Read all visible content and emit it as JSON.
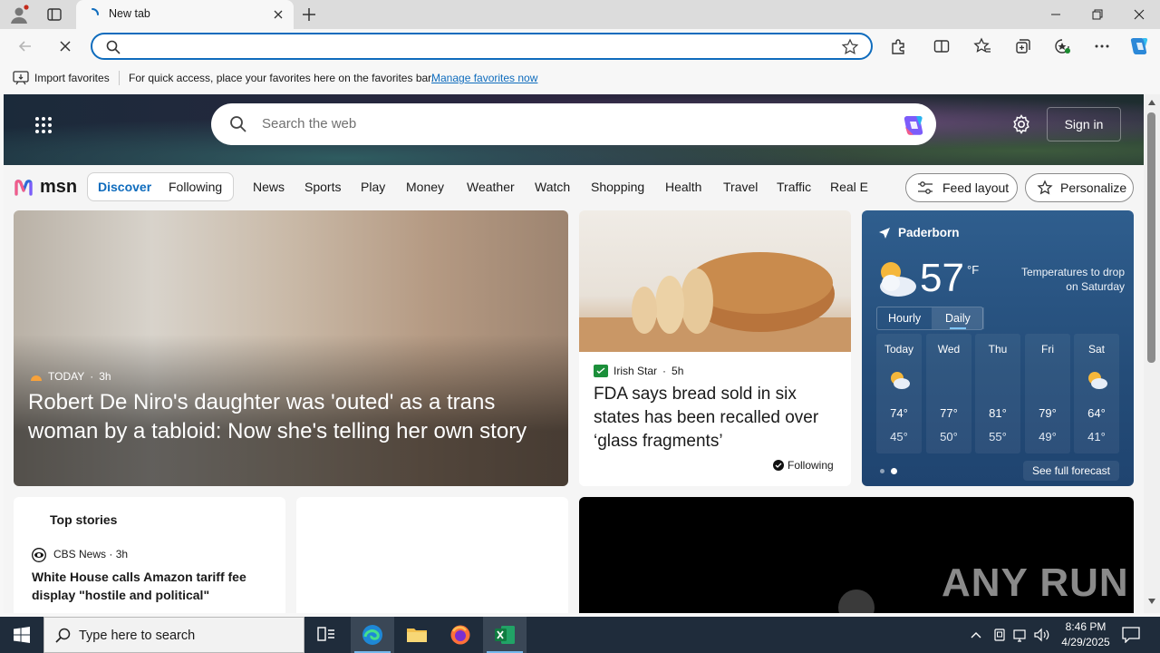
{
  "browser": {
    "tab_title": "New tab",
    "address_value": "",
    "favorites_bar": {
      "import_label": "Import favorites",
      "message": "For quick access, place your favorites here on the favorites bar.",
      "manage_link": "Manage favorites now"
    }
  },
  "msn": {
    "search_placeholder": "Search the web",
    "sign_in_label": "Sign in",
    "logo_text": "msn",
    "tabs": [
      {
        "label": "Discover",
        "active": true
      },
      {
        "label": "Following",
        "active": false
      }
    ],
    "nav": [
      "News",
      "Sports",
      "Play",
      "Money",
      "Weather",
      "Watch",
      "Shopping",
      "Health",
      "Travel",
      "Traffic",
      "Real E"
    ],
    "feed_layout_label": "Feed layout",
    "personalize_label": "Personalize"
  },
  "hero": {
    "source": "TODAY",
    "age": "3h",
    "headline": "Robert De Niro's daughter was 'outed' as a trans woman by a tabloid: Now she's telling her own story"
  },
  "story2": {
    "source": "Irish Star",
    "age": "5h",
    "headline": "FDA says bread sold in six states has been recalled over ‘glass fragments’",
    "following_label": "Following"
  },
  "weather": {
    "location": "Paderborn",
    "temp": "57",
    "unit": "°F",
    "note": "Temperatures to drop on Saturday",
    "tabs": [
      "Hourly",
      "Daily"
    ],
    "active_tab": "Daily",
    "forecast": [
      {
        "day": "Today",
        "hi": "74°",
        "lo": "45°",
        "icon": "partly-cloudy-icon"
      },
      {
        "day": "Wed",
        "hi": "77°",
        "lo": "50°",
        "icon": "sunny-icon"
      },
      {
        "day": "Thu",
        "hi": "81°",
        "lo": "55°",
        "icon": "sunny-icon"
      },
      {
        "day": "Fri",
        "hi": "79°",
        "lo": "49°",
        "icon": "sunny-icon"
      },
      {
        "day": "Sat",
        "hi": "64°",
        "lo": "41°",
        "icon": "partly-cloudy-icon"
      }
    ],
    "full_forecast_label": "See full forecast"
  },
  "top_stories": {
    "title": "Top stories",
    "source": "CBS News",
    "age": "3h",
    "headline": "White House calls Amazon tariff fee display \"hostile and political\""
  },
  "watermark": "ANY RUN",
  "taskbar": {
    "search_placeholder": "Type here to search",
    "time": "8:46 PM",
    "date": "4/29/2025"
  },
  "colors": {
    "accent": "#0f6cbd",
    "taskbar": "#1f2c3b",
    "weather_card": "#2a5584"
  }
}
